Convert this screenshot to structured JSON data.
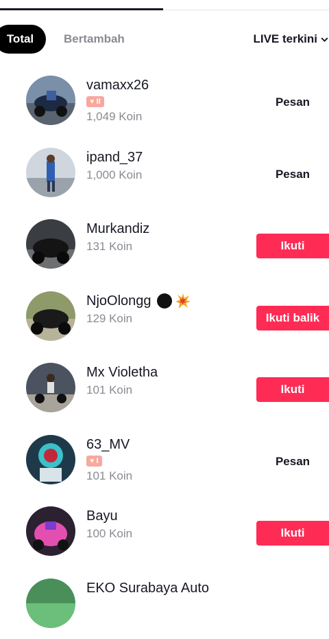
{
  "filters": {
    "total": "Total",
    "bertambah": "Bertambah",
    "sort_label": "LIVE terkini"
  },
  "colors": {
    "accent": "#fe2c55",
    "text": "#161823",
    "muted": "#8a8b91",
    "badge": "#f7a8a0"
  },
  "users": [
    {
      "name": "vamaxx26",
      "badge": "II",
      "koin": "1,049 Koin",
      "action": "Pesan",
      "style": "plain"
    },
    {
      "name": "ipand_37",
      "badge": "",
      "koin": "1,000 Koin",
      "action": "Pesan",
      "style": "plain"
    },
    {
      "name": "Murkandiz",
      "badge": "",
      "koin": "131 Koin",
      "action": "Ikuti",
      "style": "red"
    },
    {
      "name": "NjoOlongg",
      "badge": "",
      "koin": "129 Koin",
      "action": "Ikuti balik",
      "style": "red"
    },
    {
      "name": "Mx Violetha",
      "badge": "",
      "koin": "101 Koin",
      "action": "Ikuti",
      "style": "red"
    },
    {
      "name": "63_MV",
      "badge": "I",
      "koin": "101 Koin",
      "action": "Pesan",
      "style": "plain"
    },
    {
      "name": "Bayu",
      "badge": "",
      "koin": "100 Koin",
      "action": "Ikuti",
      "style": "red"
    },
    {
      "name": "EKO Surabaya Auto",
      "badge": "",
      "koin": "",
      "action": "",
      "style": "plain"
    }
  ]
}
